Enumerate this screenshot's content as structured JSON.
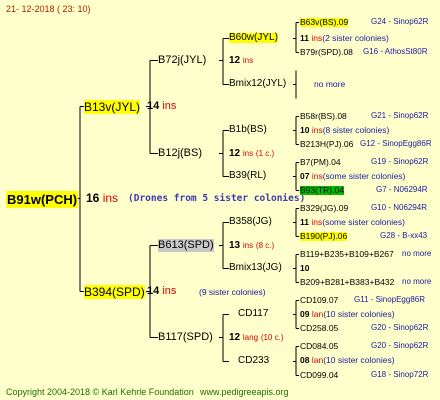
{
  "date": "21- 12-2018 ( 23: 10)",
  "root": {
    "name": "B91w(PCH)",
    "count": "16",
    "unit": "ins",
    "note": "(Drones from 5 sister colonies)"
  },
  "gen1": [
    {
      "name": "B13v(JYL)",
      "count": "14",
      "unit": "ins"
    },
    {
      "name": "B394(SPD)",
      "count": "14",
      "unit": "ins",
      "note": "(9 sister colonies)"
    }
  ],
  "gen2": [
    {
      "name": "B72j(JYL)",
      "count": "12",
      "unit": "ins"
    },
    {
      "name": "B12j(BS)",
      "count": "12",
      "unit": "ins",
      "note": "(1 c.)"
    },
    {
      "name": "B613(SPD)",
      "count": "13",
      "unit": "ins",
      "note": "(8 c.)"
    },
    {
      "name": "B117(SPD)",
      "count": "12",
      "unit": "lang",
      "note": "(10 c.)"
    }
  ],
  "gen3": [
    {
      "name": "B60w(JYL)",
      "count": "11",
      "unit": "ins",
      "note": "(2 sister colonies)"
    },
    {
      "name": "Bmix12(JYL)",
      "note": "no more"
    },
    {
      "name": "B1b(BS)",
      "count": "10",
      "unit": "ins",
      "note": "(8 sister colonies)"
    },
    {
      "name": "B39(RL)",
      "count": "07",
      "unit": "ins",
      "note": "(some sister colonies)"
    },
    {
      "name": "B358(JG)",
      "count": "11",
      "unit": "ins",
      "note": "(some sister colonies)"
    },
    {
      "name": "Bmix13(JG)",
      "count": "10",
      "unit": "",
      "note": ""
    },
    {
      "name": "CD117",
      "count": "09",
      "unit": "lan",
      "note": "(10 sister colonies)"
    },
    {
      "name": "CD233",
      "count": "08",
      "unit": "lan",
      "note": "(10 sister colonies)"
    }
  ],
  "gen4": [
    {
      "name": "B63v(BS).09",
      "code": "G24 - Sinop62R"
    },
    {
      "name": "B79r(SPD).08",
      "code": "G16 - AthosSt80R"
    },
    {
      "name": "B58r(BS).08",
      "code": "G21 - Sinop62R"
    },
    {
      "name": "B213H(PJ).06",
      "code": "G12 - SinopEgg86R"
    },
    {
      "name": "B7(PM).04",
      "code": "G19 - Sinop62R"
    },
    {
      "name": "B93(TR).04",
      "code": "G7 - N06294R"
    },
    {
      "name": "B329(JG).09",
      "code": "G10 - N06294R"
    },
    {
      "name": "B190(PJ).06",
      "code": "G28 - B-xx43"
    },
    {
      "name": "B119+B235+B109+B267",
      "code": "no more"
    },
    {
      "name": "B209+B281+B383+B432",
      "code": "no more"
    },
    {
      "name": "CD109.07",
      "code": "G11 - SinopEgg86R"
    },
    {
      "name": "CD258.05",
      "code": "G20 - Sinop62R"
    },
    {
      "name": "CD084.05",
      "code": "G20 - Sinop62R"
    },
    {
      "name": "CD099.04",
      "code": "G18 - Sinop72R"
    }
  ],
  "footer": {
    "copyright": "Copyright 2004-2018 © Karl Kehrle Foundation",
    "url": "www.pedigreeapis.org"
  }
}
